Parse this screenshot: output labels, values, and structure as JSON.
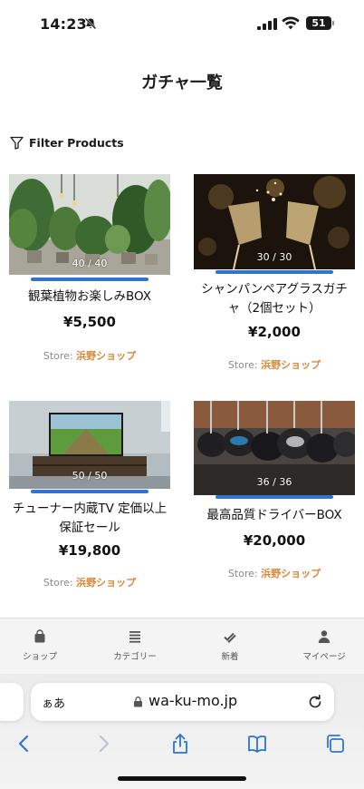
{
  "status_bar": {
    "time": "14:23",
    "battery": "51"
  },
  "page": {
    "title": "ガチャ一覧"
  },
  "filter": {
    "label": "Filter Products",
    "icon": "funnel-icon"
  },
  "products": [
    {
      "title": "観葉植物お楽しみBOX",
      "price": "¥5,500",
      "count": "40 / 40",
      "remaining_fraction": 1.0,
      "store_prefix": "Store:",
      "store_name": "浜野ショップ",
      "image": "house-plants"
    },
    {
      "title": "シャンパンペアグラスガチャ（2個セット）",
      "price": "¥2,000",
      "count": "30 / 30",
      "remaining_fraction": 1.0,
      "store_prefix": "Store:",
      "store_name": "浜野ショップ",
      "image": "champagne-glasses"
    },
    {
      "title": "チューナー内蔵TV 定価以上保証セール",
      "price": "¥19,800",
      "count": "50 / 50",
      "remaining_fraction": 1.0,
      "store_prefix": "Store:",
      "store_name": "浜野ショップ",
      "image": "television"
    },
    {
      "title": "最高品質ドライバーBOX",
      "price": "¥20,000",
      "count": "36 / 36",
      "remaining_fraction": 1.0,
      "store_prefix": "Store:",
      "store_name": "浜野ショップ",
      "image": "golf-drivers"
    }
  ],
  "app_nav": [
    {
      "label": "ショップ",
      "icon": "shopping-bag-icon"
    },
    {
      "label": "カテゴリー",
      "icon": "list-icon"
    },
    {
      "label": "新着",
      "icon": "double-check-icon"
    },
    {
      "label": "マイページ",
      "icon": "user-icon"
    }
  ],
  "browser": {
    "aa": "ぁあ",
    "url": "wa-ku-mo.jp"
  },
  "colors": {
    "accent": "#2f74d0",
    "store": "#d8893a"
  }
}
